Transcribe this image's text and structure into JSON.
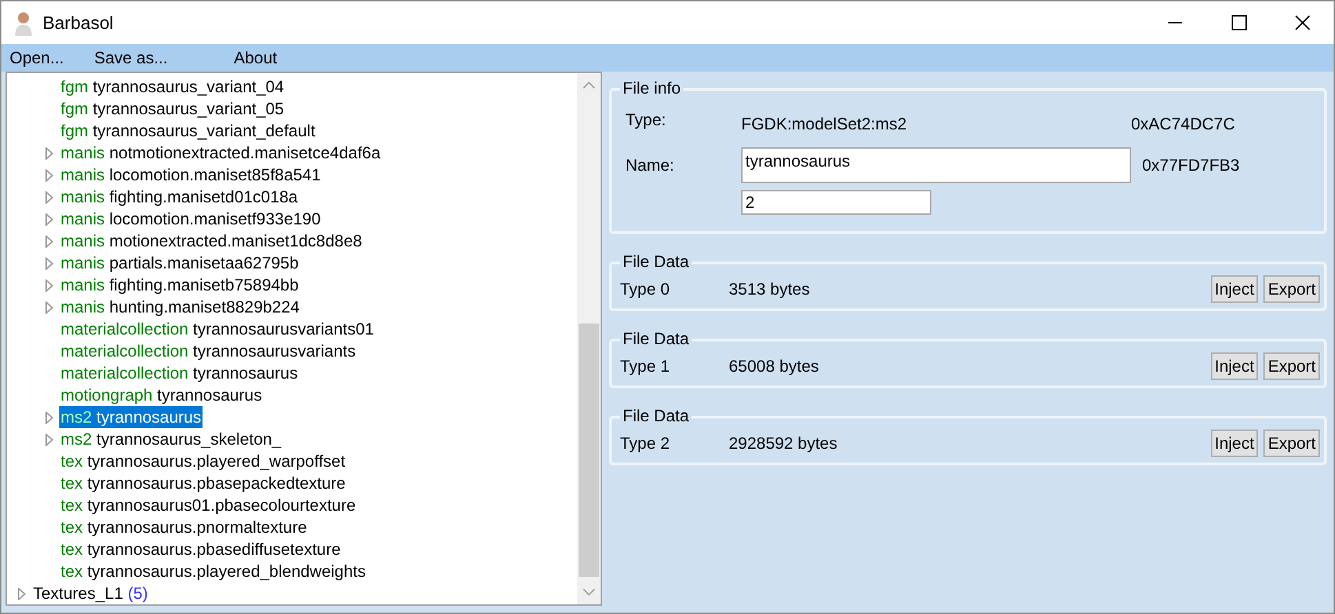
{
  "window": {
    "title": "Barbasol"
  },
  "menu": [
    "Open...",
    "Save as...",
    "About"
  ],
  "tree": {
    "nested_items": [
      {
        "prefix": "fgm",
        "name": "tyrannosaurus_variant_04",
        "expandable": false,
        "selected": false
      },
      {
        "prefix": "fgm",
        "name": "tyrannosaurus_variant_05",
        "expandable": false,
        "selected": false
      },
      {
        "prefix": "fgm",
        "name": "tyrannosaurus_variant_default",
        "expandable": false,
        "selected": false
      },
      {
        "prefix": "manis",
        "name": "notmotionextracted.manisetce4daf6a",
        "expandable": true,
        "selected": false
      },
      {
        "prefix": "manis",
        "name": "locomotion.maniset85f8a541",
        "expandable": true,
        "selected": false
      },
      {
        "prefix": "manis",
        "name": "fighting.manisetd01c018a",
        "expandable": true,
        "selected": false
      },
      {
        "prefix": "manis",
        "name": "locomotion.manisetf933e190",
        "expandable": true,
        "selected": false
      },
      {
        "prefix": "manis",
        "name": "motionextracted.maniset1dc8d8e8",
        "expandable": true,
        "selected": false
      },
      {
        "prefix": "manis",
        "name": "partials.manisetaa62795b",
        "expandable": true,
        "selected": false
      },
      {
        "prefix": "manis",
        "name": "fighting.manisetb75894bb",
        "expandable": true,
        "selected": false
      },
      {
        "prefix": "manis",
        "name": "hunting.maniset8829b224",
        "expandable": true,
        "selected": false
      },
      {
        "prefix": "materialcollection",
        "name": "tyrannosaurusvariants01",
        "expandable": false,
        "selected": false
      },
      {
        "prefix": "materialcollection",
        "name": "tyrannosaurusvariants",
        "expandable": false,
        "selected": false
      },
      {
        "prefix": "materialcollection",
        "name": "tyrannosaurus",
        "expandable": false,
        "selected": false
      },
      {
        "prefix": "motiongraph",
        "name": "tyrannosaurus",
        "expandable": false,
        "selected": false
      },
      {
        "prefix": "ms2",
        "name": "tyrannosaurus",
        "expandable": true,
        "selected": true
      },
      {
        "prefix": "ms2",
        "name": "tyrannosaurus_skeleton_",
        "expandable": true,
        "selected": false
      },
      {
        "prefix": "tex",
        "name": "tyrannosaurus.playered_warpoffset",
        "expandable": false,
        "selected": false
      },
      {
        "prefix": "tex",
        "name": "tyrannosaurus.pbasepackedtexture",
        "expandable": false,
        "selected": false
      },
      {
        "prefix": "tex",
        "name": "tyrannosaurus01.pbasecolourtexture",
        "expandable": false,
        "selected": false
      },
      {
        "prefix": "tex",
        "name": "tyrannosaurus.pnormaltexture",
        "expandable": false,
        "selected": false
      },
      {
        "prefix": "tex",
        "name": "tyrannosaurus.pbasediffusetexture",
        "expandable": false,
        "selected": false
      },
      {
        "prefix": "tex",
        "name": "tyrannosaurus.playered_blendweights",
        "expandable": false,
        "selected": false
      }
    ],
    "root_items": [
      {
        "name": "Textures_L1",
        "count": "(5)",
        "expandable": true,
        "selected": false
      }
    ]
  },
  "file_info": {
    "title": "File info",
    "type_label": "Type:",
    "type_value": "FGDK:modelSet2:ms2",
    "type_hash": "0xAC74DC7C",
    "name_label": "Name:",
    "name_value": "tyrannosaurus",
    "name_hash": "0x77FD7FB3",
    "extra_value": "2"
  },
  "file_data": [
    {
      "title": "File Data",
      "type": "Type 0",
      "size": "3513 bytes",
      "buttons": [
        "Inject",
        "Export"
      ]
    },
    {
      "title": "File Data",
      "type": "Type 1",
      "size": "65008 bytes",
      "buttons": [
        "Inject",
        "Export"
      ]
    },
    {
      "title": "File Data",
      "type": "Type 2",
      "size": "2928592 bytes",
      "buttons": [
        "Inject",
        "Export"
      ]
    }
  ]
}
